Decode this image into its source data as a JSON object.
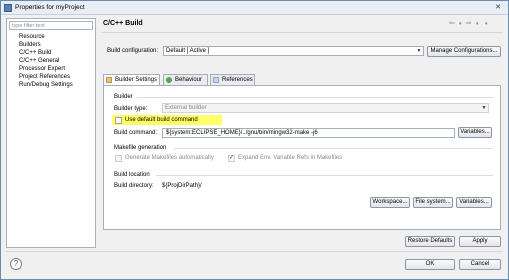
{
  "window": {
    "title": "Properties for myProject",
    "close": "✕"
  },
  "sidebar": {
    "filter_placeholder": "type filter text",
    "items": [
      {
        "label": "Resource"
      },
      {
        "label": "Builders"
      },
      {
        "label": "C/C++ Build"
      },
      {
        "label": "C/C++ General"
      },
      {
        "label": "Processor Expert"
      },
      {
        "label": "Project References"
      },
      {
        "label": "Run/Debug Settings"
      }
    ]
  },
  "main": {
    "title": "C/C++ Build",
    "nav_icons": [
      "back-icon",
      "back-dropdown-icon",
      "forward-icon",
      "forward-dropdown-icon",
      "menu-icon"
    ],
    "build_configuration_label": "Build configuration:",
    "build_configuration_value": "Default  [ Active ]",
    "manage_configurations": "Manage Configurations...",
    "tabs": [
      {
        "label": "Builder Settings",
        "icon": "builder-icon",
        "active": true
      },
      {
        "label": "Behaviour",
        "icon": "behaviour-icon",
        "active": false
      },
      {
        "label": "References",
        "icon": "references-icon",
        "active": false
      }
    ]
  },
  "builder": {
    "group_title": "Builder",
    "type_label": "Builder type:",
    "type_value": "External builder",
    "use_default_label": "Use default build command",
    "use_default_checked": false,
    "command_label": "Build command:",
    "command_value": "${system:ECLIPSE_HOME}/../gnu/bin/mingw32-make -j6",
    "variables": "Variables..."
  },
  "makefile": {
    "group_title": "Makefile generation",
    "generate_label": "Generate Makefiles automatically",
    "generate_checked": false,
    "expand_label": "Expand Env. Variable Refs in Makefiles",
    "expand_checked": true
  },
  "location": {
    "group_title": "Build location",
    "dir_label": "Build directory:",
    "dir_value": "${ProjDirPath}/",
    "workspace": "Workspace...",
    "filesystem": "File system...",
    "variables": "Variables..."
  },
  "footer": {
    "restore_defaults": "Restore Defaults",
    "apply": "Apply",
    "ok": "OK",
    "cancel": "Cancel",
    "help": "?"
  },
  "colors": {
    "highlight": "#ffff66",
    "border": "#a6aeb8",
    "accent": "#5a7fb0"
  }
}
